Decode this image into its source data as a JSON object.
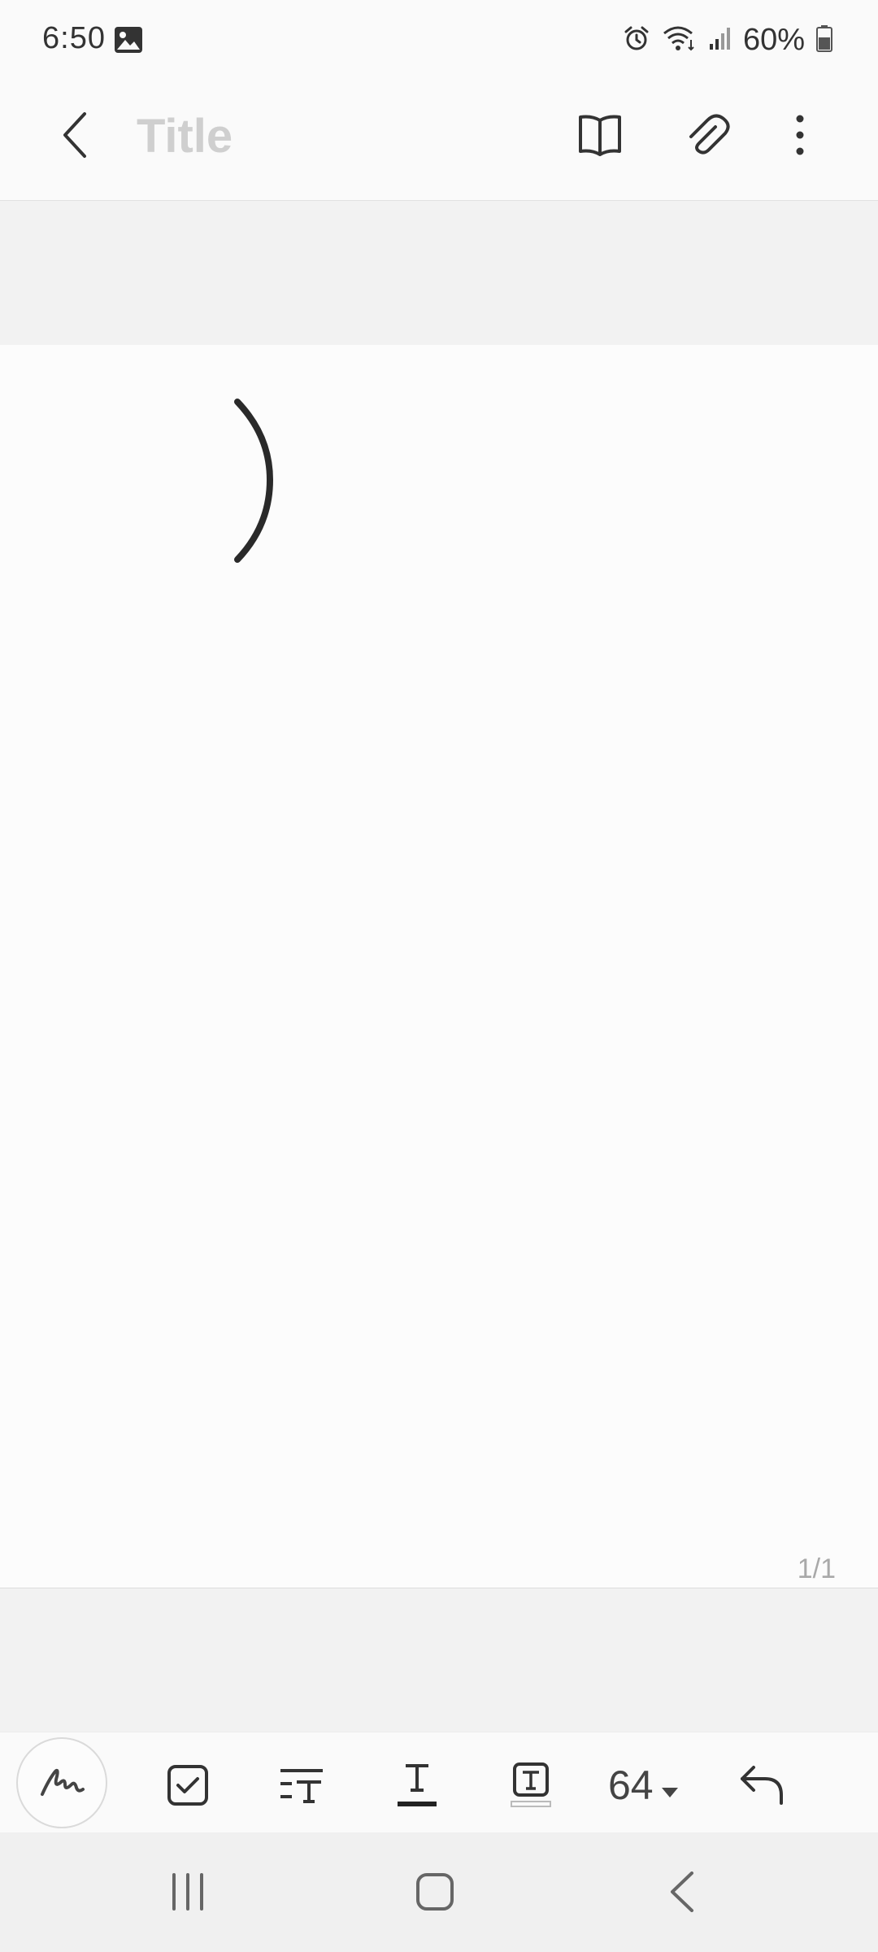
{
  "status_bar": {
    "time": "6:50",
    "battery": "60%",
    "icons": [
      "gallery-icon",
      "alarm-icon",
      "wifi-icon",
      "signal-icon",
      "battery-icon"
    ]
  },
  "toolbar": {
    "title_placeholder": "Title",
    "icons": [
      "back-arrow-icon",
      "book-icon",
      "paperclip-icon",
      "more-vert-icon"
    ]
  },
  "canvas": {
    "handwriting": ")"
  },
  "page_indicator": "1/1",
  "format_bar": {
    "font_size": "64",
    "icons": [
      "pen-icon",
      "checkbox-icon",
      "text-style-icon",
      "underline-text-icon",
      "text-box-icon",
      "dropdown-triangle-icon",
      "undo-icon"
    ]
  },
  "nav_bar": {
    "icons": [
      "recents-icon",
      "home-icon",
      "back-icon"
    ]
  },
  "colors": {
    "background": "#f2f2f2",
    "canvas": "#fcfcfc",
    "icon": "#333333",
    "placeholder": "#cfcfcf"
  }
}
